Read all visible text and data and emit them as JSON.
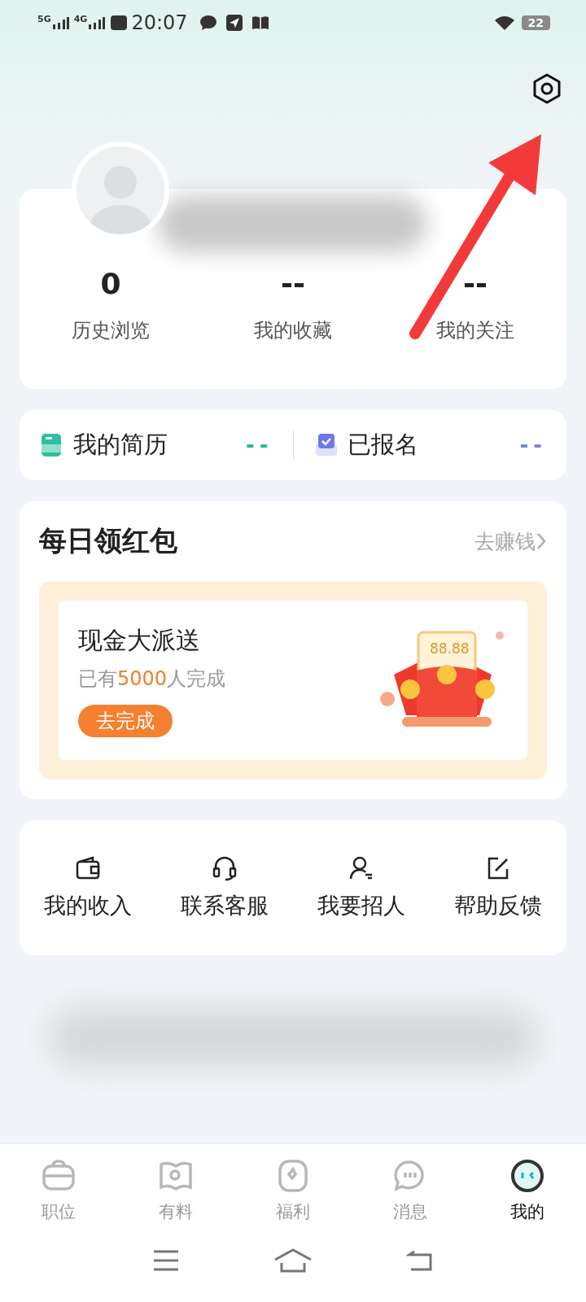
{
  "status_bar": {
    "signals": [
      "5G",
      "4G"
    ],
    "time": "20:07",
    "battery": "22"
  },
  "profile": {
    "stats": [
      {
        "value": "0",
        "label": "历史浏览"
      },
      {
        "value": "--",
        "label": "我的收藏"
      },
      {
        "value": "--",
        "label": "我的关注"
      }
    ]
  },
  "quick_links": [
    {
      "kind": "pdf",
      "label": "我的简历",
      "value": "--",
      "color": "#20b89c"
    },
    {
      "kind": "check",
      "label": "已报名",
      "value": "--",
      "color": "#7080e0"
    }
  ],
  "daily_red_packet": {
    "title": "每日领红包",
    "link": "去赚钱",
    "task": {
      "title": "现金大派送",
      "subtitle": "已有**5000**人完成",
      "button": "去完成",
      "amount": "88.88"
    }
  },
  "services": [
    {
      "kind": "wallet",
      "label": "我的收入"
    },
    {
      "kind": "headset",
      "label": "联系客服"
    },
    {
      "kind": "person",
      "label": "我要招人"
    },
    {
      "kind": "edit",
      "label": "帮助反馈"
    }
  ],
  "tab_bar": [
    {
      "kind": "briefcase",
      "label": "职位",
      "selected": false
    },
    {
      "kind": "book",
      "label": "有料",
      "selected": false
    },
    {
      "kind": "star",
      "label": "福利",
      "selected": false
    },
    {
      "kind": "chat",
      "label": "消息",
      "selected": false
    },
    {
      "kind": "face",
      "label": "我的",
      "selected": true
    }
  ]
}
